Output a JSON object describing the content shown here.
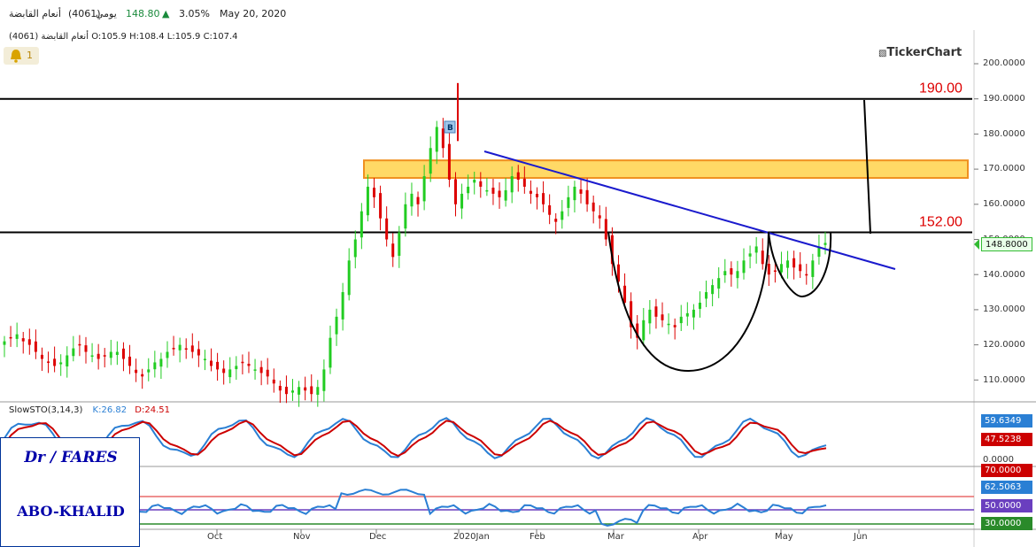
{
  "header": {
    "symbol": "أنعام القابضة",
    "code": "(4061)",
    "period": "يومي",
    "price": "148.80",
    "change": "3.05%",
    "date": "May 20, 2020",
    "up_color": "#1a8a3c"
  },
  "ohlc": {
    "symbol_code": "(4061) أنعام القابضة",
    "o": "O:105.9",
    "h": "H:108.4",
    "l": "L:105.9",
    "c": "C:107.4"
  },
  "alerts": {
    "count": "1"
  },
  "brand": "TickerChart",
  "chart_data": [
    {
      "type": "candlestick",
      "y_ticks": [
        "200.0000",
        "190.0000",
        "180.0000",
        "170.0000",
        "160.0000",
        "150.0000",
        "140.0000",
        "130.0000",
        "120.0000",
        "110.0000"
      ],
      "ylim": [
        106,
        204
      ],
      "x_labels": [
        "Oct",
        "Nov",
        "Dec",
        "2020Jan",
        "Feb",
        "Mar",
        "Apr",
        "May",
        "Jun"
      ],
      "last_price": "148.8000",
      "levels": [
        {
          "value": 190,
          "label": "190.00"
        },
        {
          "value": 152,
          "label": "152.00"
        }
      ],
      "zone": {
        "low": 167.5,
        "high": 172.5,
        "color": "#ffd966"
      },
      "marker": "B",
      "colors": {
        "up": "#22cc22",
        "down": "#dd0000",
        "trend": "#1a1acd",
        "level": "#000000",
        "level_label": "#dd0000"
      },
      "closes_approx": [
        121,
        122,
        123,
        121,
        120,
        118,
        116,
        115,
        114,
        115,
        117,
        119,
        120,
        118,
        117,
        116,
        117,
        118,
        118,
        116,
        114,
        112,
        111,
        113,
        115,
        116,
        118,
        119,
        120,
        119,
        118,
        117,
        116,
        114,
        113,
        112,
        113,
        114,
        115,
        114,
        113,
        112,
        111,
        109,
        107,
        106,
        107,
        108,
        107,
        106,
        108,
        113,
        122,
        128,
        135,
        144,
        150,
        158,
        165,
        162,
        156,
        150,
        145,
        152,
        160,
        163,
        160,
        168,
        176,
        182,
        176,
        167,
        160,
        163,
        165,
        167,
        165,
        164,
        163,
        162,
        164,
        168,
        167,
        165,
        163,
        162,
        160,
        157,
        155,
        158,
        162,
        165,
        163,
        160,
        158,
        156,
        150,
        143,
        138,
        132,
        125,
        122,
        127,
        130,
        128,
        127,
        126,
        125,
        128,
        129,
        130,
        132,
        135,
        137,
        139,
        141,
        140,
        141,
        144,
        146,
        148,
        143,
        140,
        141,
        143,
        144,
        142,
        141,
        140,
        144,
        148,
        149
      ]
    },
    {
      "type": "line",
      "title": "SlowSTO(3,14,3)",
      "k_label": "K:26.82",
      "d_label": "D:24.51",
      "values_right": [
        "59.6349",
        "47.5238",
        "0.0000"
      ],
      "colors": {
        "k": "#2a7fd4",
        "d": "#cc0000"
      }
    },
    {
      "type": "line",
      "levels": [
        "70.0000",
        "62.5063",
        "50.0000",
        "30.0000"
      ],
      "colors": {
        "line": "#2a7fd4",
        "upper": "#e86a6a",
        "mid": "#6a3fbf",
        "lower": "#2a8a2a"
      }
    }
  ],
  "signature": {
    "line1": "Dr / FARES",
    "line2": "ABO-KHALID"
  }
}
